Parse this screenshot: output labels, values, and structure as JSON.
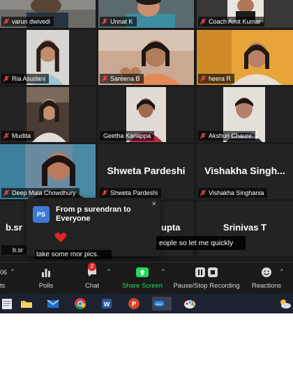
{
  "participants": [
    {
      "id": "varun",
      "name": "varun dwivedi",
      "muted": true
    },
    {
      "id": "unnat",
      "name": "Unnat K",
      "muted": true
    },
    {
      "id": "coach",
      "name": "Coach Amit Kumar",
      "muted": true
    },
    {
      "id": "ria",
      "name": "Ria Asudani",
      "muted": true
    },
    {
      "id": "sareena",
      "name": "Sareena B",
      "muted": true
    },
    {
      "id": "heera",
      "name": "heera R",
      "muted": true
    },
    {
      "id": "mudita",
      "name": "Mudita",
      "muted": true
    },
    {
      "id": "geetha",
      "name": "Geetha Kariappa",
      "muted": false
    },
    {
      "id": "akshun",
      "name": "Akshun Chaure",
      "muted": true
    },
    {
      "id": "deep",
      "name": "Deep Mala Chowdhury",
      "muted": true
    },
    {
      "id": "shweta",
      "name": "Shweta Pardeshi",
      "display_name": "Shweta Pardeshi",
      "muted": true
    },
    {
      "id": "vishakha",
      "name": "Vishakha Singhania",
      "display_name": "Vishakha Singh...",
      "muted": true
    },
    {
      "id": "b",
      "name": "b.sr",
      "display_name": "b.sr",
      "muted": false
    },
    {
      "id": "gupta",
      "display_name": "upta"
    },
    {
      "id": "srinivas",
      "display_name": "Srinivas T"
    }
  ],
  "chat_popup": {
    "avatar_initials": "PS",
    "title": "From p surendran to Everyone",
    "close_label": "×",
    "message_icon": "red-heart-icon"
  },
  "caption": {
    "line1": "eople so let me quickly",
    "line2": "take some mor pics."
  },
  "toolbar": {
    "left_fragment_top": "06",
    "left_fragment_bottom": "ts",
    "polls_label": "Polls",
    "chat_label": "Chat",
    "chat_badge": "2",
    "share_label": "Share Screen",
    "record_label": "Pause/Stop Recording",
    "reactions_label": "Reactions",
    "caret": "^",
    "share_color": "#23d959"
  },
  "taskbar": {
    "icons": [
      "notepad-icon",
      "file-explorer-icon",
      "mail-icon",
      "chrome-icon",
      "word-icon",
      "powerpoint-icon",
      "zoom-icon",
      "paint-icon",
      "weather-icon"
    ]
  },
  "colors": {
    "active_speaker": "#f7d23f",
    "muted_red": "#e5484d",
    "badge_red": "#e0262a"
  }
}
